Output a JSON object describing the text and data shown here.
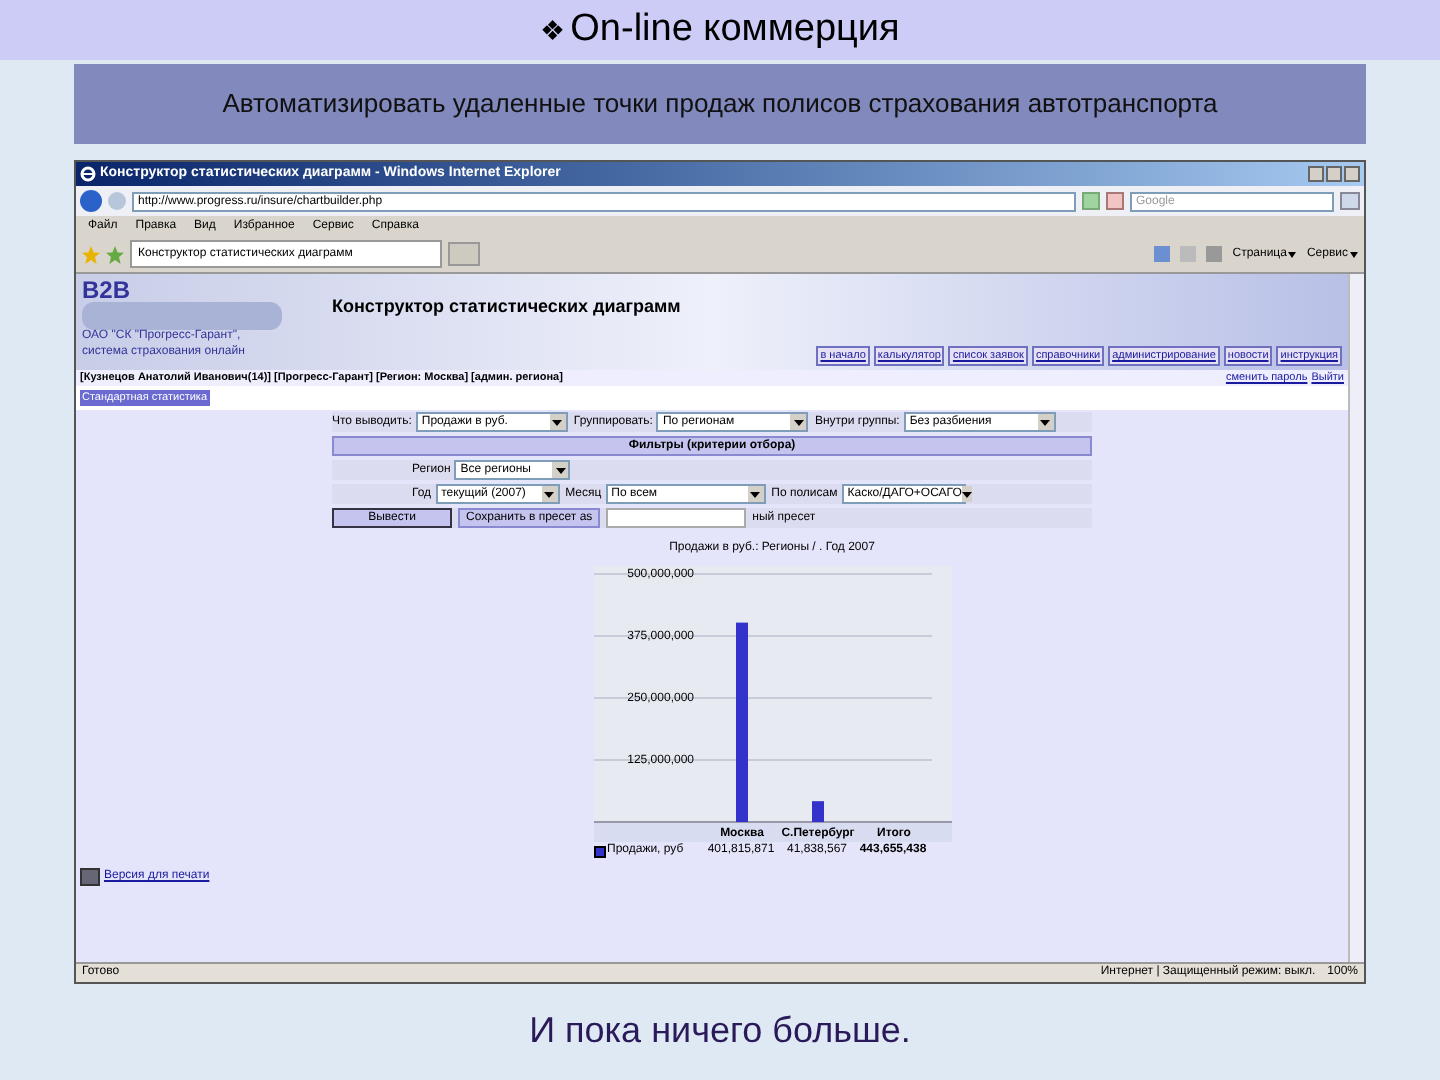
{
  "slide": {
    "title_bullet": "❖",
    "title": "On-line коммерция",
    "subtitle": "Автоматизировать удаленные точки продаж полисов страхования автотранспорта",
    "caption": "И пока ничего больше."
  },
  "browser": {
    "title": "Конструктор статистических диаграмм - Windows Internet Explorer",
    "url": "http://www.progress.ru/insure/chartbuilder.php",
    "search_placeholder": "Google",
    "menu": [
      "Файл",
      "Правка",
      "Вид",
      "Избранное",
      "Сервис",
      "Справка"
    ],
    "tabs": [
      {
        "label": "Конструктор статистических диаграмм",
        "selected": true
      }
    ],
    "tools": [
      "Страница",
      "Сервис"
    ],
    "status": "Готово",
    "zone": "Интернет | Защищенный режим: выкл.",
    "zoom": "100%"
  },
  "page": {
    "logo": "B2B",
    "company": "ОАО \"СК \"Прогресс-Гарант\",",
    "company_sub": "система страхования онлайн",
    "heading": "Конструктор статистических диаграмм",
    "nav": [
      {
        "label": "в начало"
      },
      {
        "label": "калькулятор"
      },
      {
        "label": "список заявок"
      },
      {
        "label": "справочники"
      },
      {
        "label": "администрирование"
      },
      {
        "label": "новости"
      },
      {
        "label": "инструкция"
      }
    ],
    "user": "[Кузнецов Анатолий Иванович(14)] [Прогресс-Гарант] [Регион: Москва] [админ. региона]",
    "change_password": "сменить пароль",
    "logout": "Выйти",
    "standard_button": "Стандартная статистика",
    "form": {
      "row1": [
        {
          "label": "Что выводить:",
          "value": "Продажи в руб."
        },
        {
          "label": "Группировать:",
          "value": "По регионам"
        },
        {
          "label": "Внутри группы:",
          "value": "Без разбиения"
        }
      ],
      "filters_header": "Фильтры (критерии отбора)",
      "region": {
        "label": "Регион",
        "value": "Все регионы"
      },
      "row3": [
        {
          "label": "Год",
          "value": "текущий (2007)"
        },
        {
          "label": "Месяц",
          "value": "По всем"
        },
        {
          "label": "По полисам",
          "value": "Каско/ДАГО+ОСАГО"
        }
      ],
      "show_button": "Вывести",
      "save_button": "Сохранить в пресет as",
      "preset_suffix": "ный пресет"
    },
    "chart_title": "Продажи в руб.: Регионы / . Год 2007",
    "chart_data": {
      "type": "bar",
      "categories": [
        "Москва",
        "С.Петербург",
        "Итого"
      ],
      "series": [
        {
          "name": "Продажи, руб",
          "color": "#3333cc",
          "values": [
            402000000,
            42000000,
            null
          ]
        }
      ],
      "ylim": [
        0,
        500000000
      ],
      "grid": true,
      "yticks": [
        {
          "value": 125000000,
          "label": "125,000,000"
        },
        {
          "value": 250000000,
          "label": "250,000,000"
        },
        {
          "value": 375000000,
          "label": "375,000,000"
        },
        {
          "value": 500000000,
          "label": "500,000,000"
        }
      ]
    },
    "table_values": [
      "401,815,871",
      "41,838,567",
      "443,655,438"
    ],
    "print_link": "Версия для печати"
  }
}
